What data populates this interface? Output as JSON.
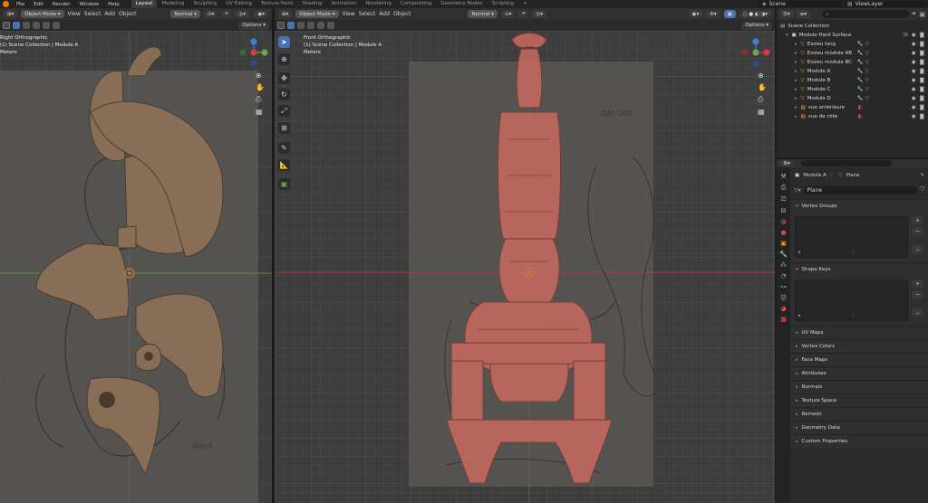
{
  "topbar": {
    "menus": [
      "File",
      "Edit",
      "Render",
      "Window",
      "Help"
    ],
    "workspaces": [
      "Layout",
      "Modeling",
      "Sculpting",
      "UV Editing",
      "Texture Paint",
      "Shading",
      "Animation",
      "Rendering",
      "Compositing",
      "Geometry Nodes",
      "Scripting",
      "+"
    ],
    "active_workspace": "Layout",
    "scene": "Scene",
    "view_layer": "ViewLayer"
  },
  "left_view": {
    "mode": "Object Mode",
    "menus": [
      "View",
      "Select",
      "Add",
      "Object"
    ],
    "transform": "Normal",
    "options": "Options",
    "info_view": "Right Orthographic",
    "info_collection": "(1) Scene Collection | Module A",
    "info_units": "Meters"
  },
  "right_view": {
    "mode": "Object Mode",
    "menus": [
      "View",
      "Select",
      "Add",
      "Object"
    ],
    "transform": "Normal",
    "options": "Options",
    "info_view": "Front Orthographic",
    "info_collection": "(1) Scene Collection | Module A",
    "info_units": "Meters",
    "ref_text": "DAY ONE"
  },
  "left_ref_text": "WAVA",
  "outliner": {
    "root": "Scene Collection",
    "collection": "Module Hard Surface",
    "items": [
      "Essieu long",
      "Essieu module AB",
      "Essieu module BC",
      "Module A",
      "Module B",
      "Module C",
      "Module D",
      "vue antérieure",
      "vue de côté"
    ]
  },
  "properties": {
    "breadcrumb_object": "Module A",
    "breadcrumb_data": "Plane",
    "data_name": "Plane",
    "sections": [
      "Vertex Groups",
      "Shape Keys",
      "UV Maps",
      "Vertex Colors",
      "Face Maps",
      "Attributes",
      "Normals",
      "Texture Space",
      "Remesh",
      "Geometry Data",
      "Custom Properties"
    ]
  },
  "colors": {
    "accent": "#4772b3",
    "mesh_front": "#c96a60",
    "mesh_side": "#8a6e55",
    "x_axis": "#d23c3c",
    "y_axis": "#6aa84f",
    "z_axis": "#3f7fd6"
  }
}
